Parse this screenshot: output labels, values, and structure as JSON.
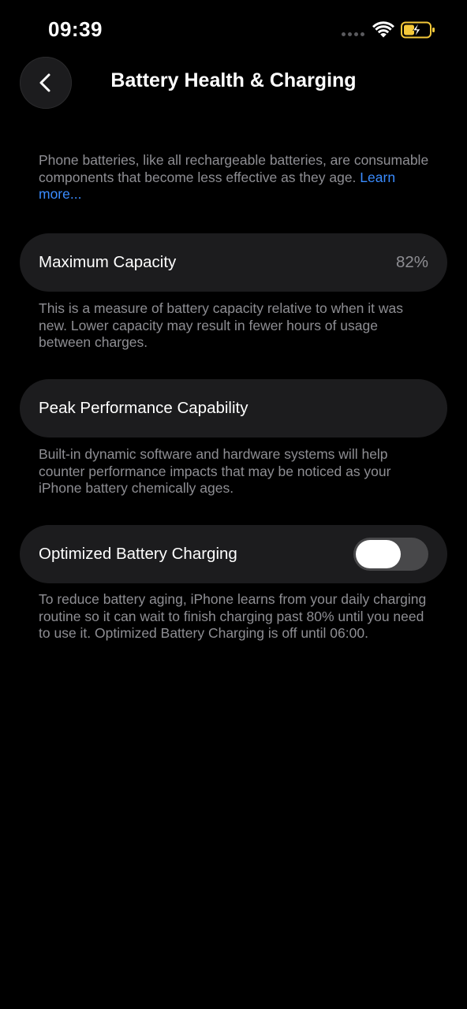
{
  "status_bar": {
    "time": "09:39",
    "icons": [
      "signal-dots-icon",
      "wifi-icon",
      "battery-charging-icon"
    ],
    "battery_color": "#f5c93a"
  },
  "nav": {
    "back_icon": "chevron-left-icon",
    "title": "Battery Health & Charging"
  },
  "intro": {
    "text": "Phone batteries, like all rechargeable batteries, are consumable components that become less effective as they age.",
    "link": "Learn more..."
  },
  "maximum_capacity": {
    "label": "Maximum Capacity",
    "value": "82%",
    "footer": "This is a measure of battery capacity relative to when it was new. Lower capacity may result in fewer hours of usage between charges."
  },
  "peak_performance": {
    "label": "Peak Performance Capability",
    "footer": "Built-in dynamic software and hardware systems will help counter performance impacts that may be noticed as your iPhone battery chemically ages."
  },
  "optimized_charging": {
    "label": "Optimized Battery Charging",
    "enabled": false,
    "footer": "To reduce battery aging, iPhone learns from your daily charging routine so it can wait to finish charging past 80% until you need to use it. Optimized Battery Charging is off until 06:00."
  },
  "colors": {
    "background": "#000000",
    "cell": "#1c1c1e",
    "secondary_text": "#8e8e93",
    "link": "#3a8cff"
  }
}
